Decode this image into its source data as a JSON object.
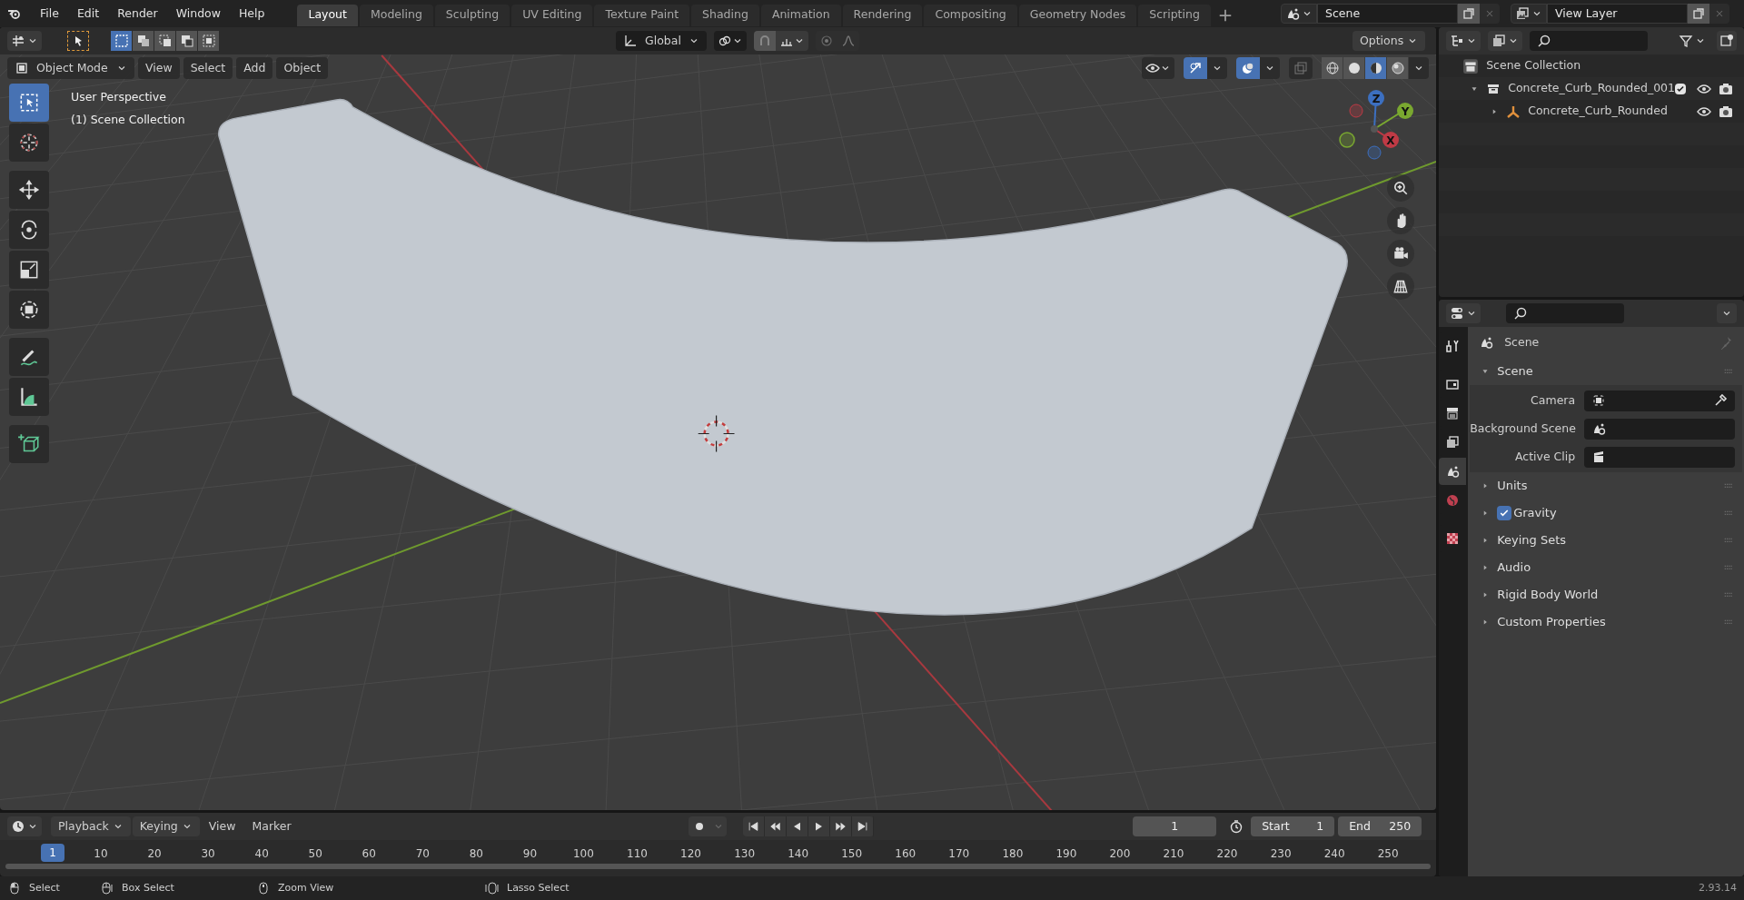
{
  "top_bar": {
    "menus": [
      "File",
      "Edit",
      "Render",
      "Window",
      "Help"
    ],
    "workspace_tabs": [
      {
        "label": "Layout",
        "selected": true
      },
      {
        "label": "Modeling",
        "selected": false
      },
      {
        "label": "Sculpting",
        "selected": false
      },
      {
        "label": "UV Editing",
        "selected": false
      },
      {
        "label": "Texture Paint",
        "selected": false
      },
      {
        "label": "Shading",
        "selected": false
      },
      {
        "label": "Animation",
        "selected": false
      },
      {
        "label": "Rendering",
        "selected": false
      },
      {
        "label": "Compositing",
        "selected": false
      },
      {
        "label": "Geometry Nodes",
        "selected": false
      },
      {
        "label": "Scripting",
        "selected": false
      }
    ],
    "scene": "Scene",
    "view_layer": "View Layer"
  },
  "viewport": {
    "select_modes": [
      {
        "selected": true
      },
      {
        "selected": false
      },
      {
        "selected": false
      },
      {
        "selected": false
      },
      {
        "selected": false
      }
    ],
    "transform_orientation": "Global",
    "options": "Options",
    "mode": "Object Mode",
    "menus": [
      "View",
      "Select",
      "Add",
      "Object"
    ],
    "gizmos_on": true,
    "overlays_on": true,
    "xray_on": false,
    "shading_modes": [
      {
        "kind": "wireframe",
        "selected": false
      },
      {
        "kind": "solid",
        "selected": false
      },
      {
        "kind": "material",
        "selected": true
      },
      {
        "kind": "rendered",
        "selected": false
      }
    ],
    "info": [
      "User Perspective",
      "(1) Scene Collection"
    ],
    "tools": [
      {
        "kind": "select",
        "selected": true
      },
      {
        "kind": "cursor",
        "selected": false
      },
      {
        "kind": "move",
        "selected": false
      },
      {
        "kind": "rotate",
        "selected": false
      },
      {
        "kind": "scale",
        "selected": false
      },
      {
        "kind": "transform",
        "selected": false
      },
      {
        "kind": "annotate",
        "selected": false
      },
      {
        "kind": "measure",
        "selected": false
      },
      {
        "kind": "add-cube",
        "selected": false
      }
    ],
    "gizmo_labels": {
      "z": "Z",
      "y": "Y",
      "x": "X"
    }
  },
  "outliner": {
    "root": "Scene Collection",
    "items": [
      {
        "label": "Concrete_Curb_Rounded_001",
        "kind": "collection",
        "expanded": true,
        "checked": true,
        "children": [
          {
            "label": "Concrete_Curb_Rounded",
            "kind": "empty",
            "expanded": false
          }
        ]
      }
    ]
  },
  "properties": {
    "tabs": [
      {
        "kind": "tool",
        "selected": false
      },
      {
        "kind": "render",
        "selected": false
      },
      {
        "kind": "output",
        "selected": false
      },
      {
        "kind": "view-layer",
        "selected": false
      },
      {
        "kind": "scene",
        "selected": true
      },
      {
        "kind": "world",
        "selected": false
      },
      {
        "kind": "texture",
        "selected": false
      }
    ],
    "title": "Scene",
    "panels": [
      {
        "label": "Scene",
        "kind": "plain",
        "expanded": true,
        "fields": [
          {
            "label": "Camera",
            "kind": "camera"
          },
          {
            "label": "Background Scene",
            "kind": "scene"
          },
          {
            "label": "Active Clip",
            "kind": "clip"
          }
        ]
      },
      {
        "label": "Units",
        "kind": "plain",
        "expanded": false
      },
      {
        "label": "Gravity",
        "kind": "toggle",
        "expanded": false,
        "checked": true
      },
      {
        "label": "Keying Sets",
        "kind": "plain",
        "expanded": false
      },
      {
        "label": "Audio",
        "kind": "plain",
        "expanded": false
      },
      {
        "label": "Rigid Body World",
        "kind": "plain",
        "expanded": false
      },
      {
        "label": "Custom Properties",
        "kind": "plain",
        "expanded": false
      }
    ]
  },
  "timeline": {
    "menus": [
      {
        "label": "Playback",
        "dropdown": true
      },
      {
        "label": "Keying",
        "dropdown": true
      },
      {
        "label": "View",
        "dropdown": false
      },
      {
        "label": "Marker",
        "dropdown": false
      }
    ],
    "current_frame": "1",
    "start_label": "Start",
    "start": "1",
    "end_label": "End",
    "end": "250",
    "playhead": "1",
    "ruler": [
      "10",
      "20",
      "30",
      "40",
      "50",
      "60",
      "70",
      "80",
      "90",
      "100",
      "110",
      "120",
      "130",
      "140",
      "150",
      "160",
      "170",
      "180",
      "190",
      "200",
      "210",
      "220",
      "230",
      "240",
      "250"
    ]
  },
  "status_bar": {
    "hints": [
      {
        "kind": "left-click",
        "label": "Select"
      },
      {
        "kind": "left-drag",
        "label": "Box Select"
      },
      {
        "kind": "middle",
        "label": "Zoom View"
      },
      {
        "kind": "lasso",
        "label": "Lasso Select"
      }
    ],
    "version": "2.93.14"
  }
}
